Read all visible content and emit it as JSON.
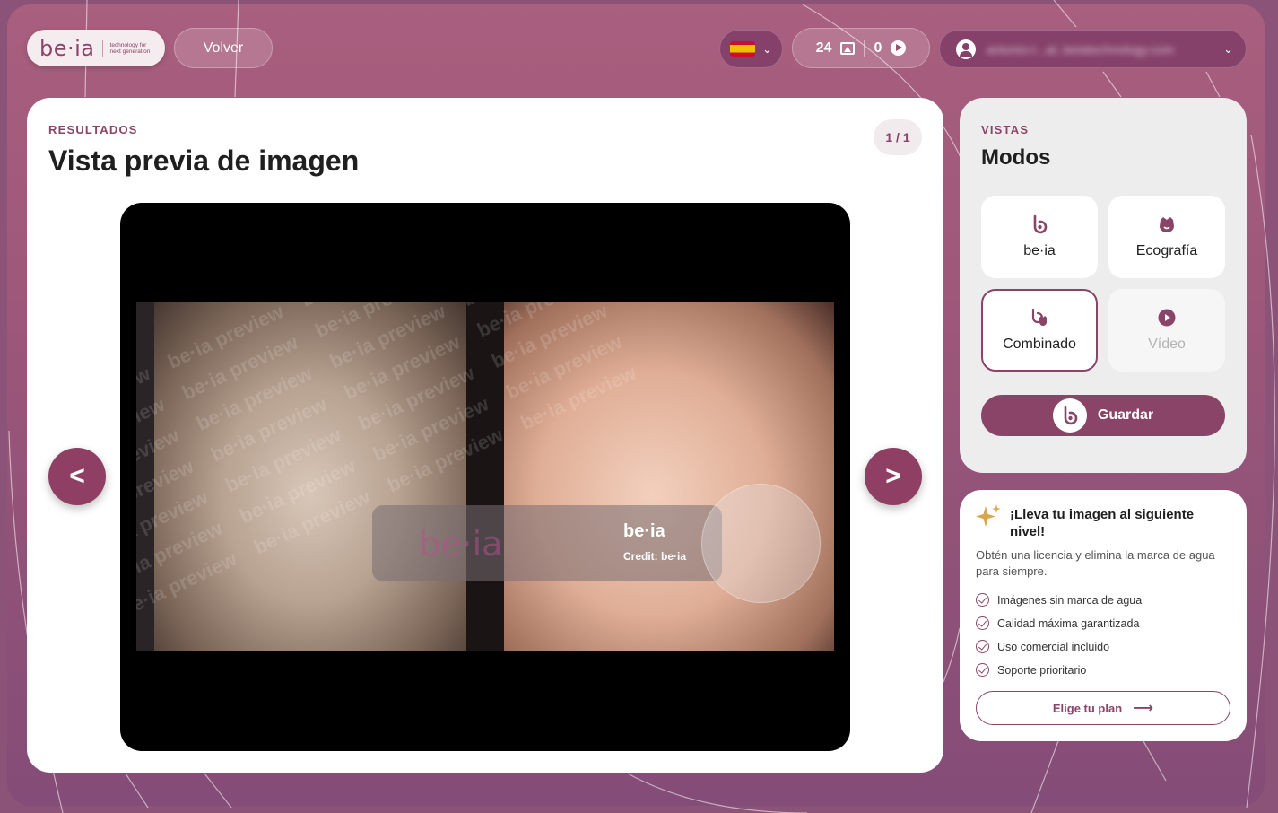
{
  "header": {
    "logo_text": "be·ia",
    "logo_tagline": "technology for next generation",
    "back_label": "Volver",
    "language_flag": "flag-es-icon",
    "image_count": "24",
    "video_count": "0",
    "user_email": "antonio-t...at..beiatechnology.com"
  },
  "results": {
    "eyebrow": "RESULTADOS",
    "title": "Vista previa de imagen",
    "page_indicator": "1 / 1",
    "prev_label": "<",
    "next_label": ">",
    "watermark_text": "be·ia preview",
    "overlay_title": "be·ia",
    "overlay_credit": "Credit: be·ia"
  },
  "views": {
    "eyebrow": "VISTAS",
    "title": "Modos",
    "modes": [
      {
        "label": "be·ia",
        "icon": "beia-icon",
        "state": "default"
      },
      {
        "label": "Ecografía",
        "icon": "ultrasound-icon",
        "state": "default"
      },
      {
        "label": "Combinado",
        "icon": "combined-icon",
        "state": "selected"
      },
      {
        "label": "Vídeo",
        "icon": "play-icon",
        "state": "disabled"
      }
    ],
    "save_label": "Guardar"
  },
  "promo": {
    "title": "¡Lleva tu imagen al siguiente nivel!",
    "description": "Obtén una licencia y elimina la marca de agua para siempre.",
    "benefits": [
      "Imágenes sin marca de agua",
      "Calidad máxima garantizada",
      "Uso comercial incluido",
      "Soporte prioritario"
    ],
    "cta_label": "Elige tu plan"
  },
  "colors": {
    "accent": "#8a4467",
    "background": "#9a5679"
  }
}
